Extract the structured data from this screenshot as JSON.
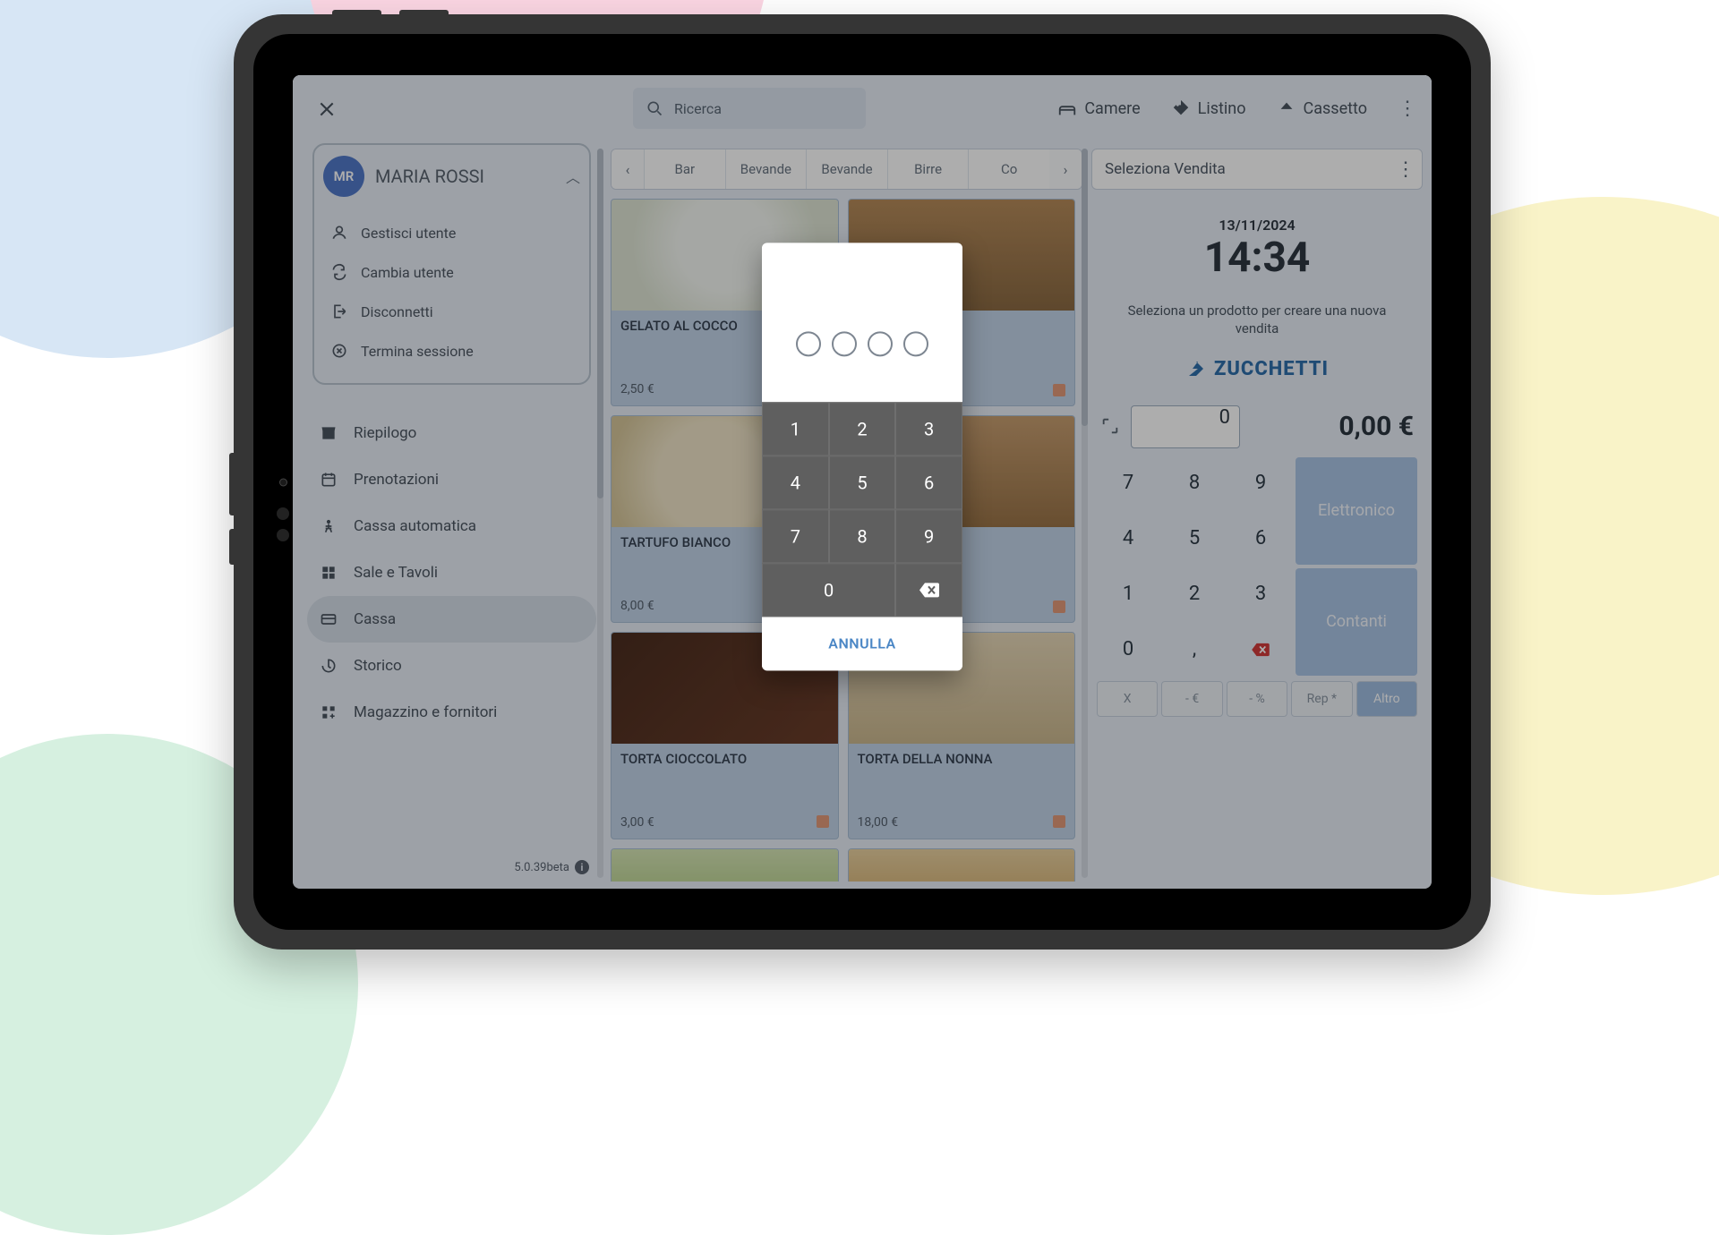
{
  "colors": {
    "accent": "#4a86c5",
    "avatar": "#5179c9"
  },
  "topbar": {
    "search_placeholder": "Ricerca",
    "rooms": "Camere",
    "pricelist": "Listino",
    "drawer": "Cassetto"
  },
  "categories": [
    "Bar",
    "Bevande",
    "Bevande",
    "Birre",
    "Co"
  ],
  "products": [
    {
      "name": "GELATO AL COCCO",
      "price": "2,50 €"
    },
    {
      "name": "",
      "price": ""
    },
    {
      "name": "TARTUFO BIANCO",
      "price": "8,00 €"
    },
    {
      "name": "",
      "price": ""
    },
    {
      "name": "TORTA CIOCCOLATO",
      "price": "3,00 €"
    },
    {
      "name": "TORTA DELLA NONNA",
      "price": "18,00 €"
    },
    {
      "name": "",
      "price": ""
    },
    {
      "name": "",
      "price": ""
    }
  ],
  "right": {
    "select_sale": "Seleziona Vendita",
    "date": "13/11/2024",
    "time": "14:34",
    "hint": "Seleziona un prodotto per creare una nuova vendita",
    "brand": "ZUCCHETTI",
    "amount_input": "0",
    "amount_total": "0,00 €",
    "keypad": [
      "7",
      "8",
      "9",
      "4",
      "5",
      "6",
      "1",
      "2",
      "3",
      "0",
      ","
    ],
    "pay_electronic": "Elettronico",
    "pay_cash": "Contanti",
    "bottom": [
      "X",
      "- €",
      "- %",
      "Rep *",
      "Altro"
    ]
  },
  "drawer": {
    "user_initials": "MR",
    "user_name": "MARIA ROSSI",
    "ops": {
      "manage": "Gestisci utente",
      "switch": "Cambia utente",
      "logout": "Disconnetti",
      "end": "Termina sessione"
    },
    "nav": {
      "summary": "Riepilogo",
      "bookings": "Prenotazioni",
      "autocash": "Cassa automatica",
      "rooms": "Sale e Tavoli",
      "register": "Cassa",
      "history": "Storico",
      "inventory": "Magazzino e fornitori"
    },
    "version": "5.0.39beta"
  },
  "pin": {
    "keys": [
      "1",
      "2",
      "3",
      "4",
      "5",
      "6",
      "7",
      "8",
      "9",
      "0"
    ],
    "cancel": "ANNULLA"
  }
}
